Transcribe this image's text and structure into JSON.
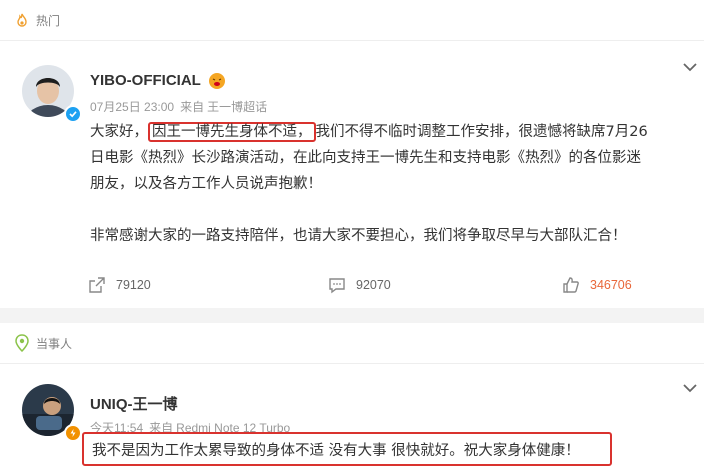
{
  "hot_label": "热门",
  "post": {
    "username": "YIBO-OFFICIAL",
    "date": "07月25日 23:00",
    "source_prefix": "来自",
    "source": "王一博超话",
    "text_prefix": "大家好，",
    "text_highlight": "因王一博先生身体不适，",
    "text_line1_rest": "我们不得不临时调整工作安排，很遗憾将缺席7月26",
    "text_line2": "日电影《热烈》长沙路演活动，在此向支持王一博先生和支持电影《热烈》的各位影迷",
    "text_line3": "朋友，以及各方工作人员说声抱歉！",
    "text_para2": "非常感谢大家的一路支持陪伴，也请大家不要担心，我们将争取尽早与大部队汇合！",
    "reposts": "79120",
    "comments": "92070",
    "likes": "346706"
  },
  "party_label": "当事人",
  "reply": {
    "username": "UNIQ-王一博",
    "time": "今天11:54",
    "source_prefix": "来自",
    "source": "Redmi Note 12 Turbo",
    "text": "我不是因为工作太累导致的身体不适 没有大事 很快就好。祝大家身体健康！"
  },
  "colors": {
    "accent_orange": "#e8673a",
    "highlight_red": "#d9322e",
    "verified_blue": "#1da1f2",
    "verified_orange": "#f29100",
    "party_green": "#8bc34a"
  },
  "icons": {
    "hot": "fire-icon",
    "party": "location-pin-icon",
    "repost": "repost-icon",
    "comment": "comment-icon",
    "like": "thumbs-up-icon",
    "chevron": "chevron-down-icon"
  }
}
